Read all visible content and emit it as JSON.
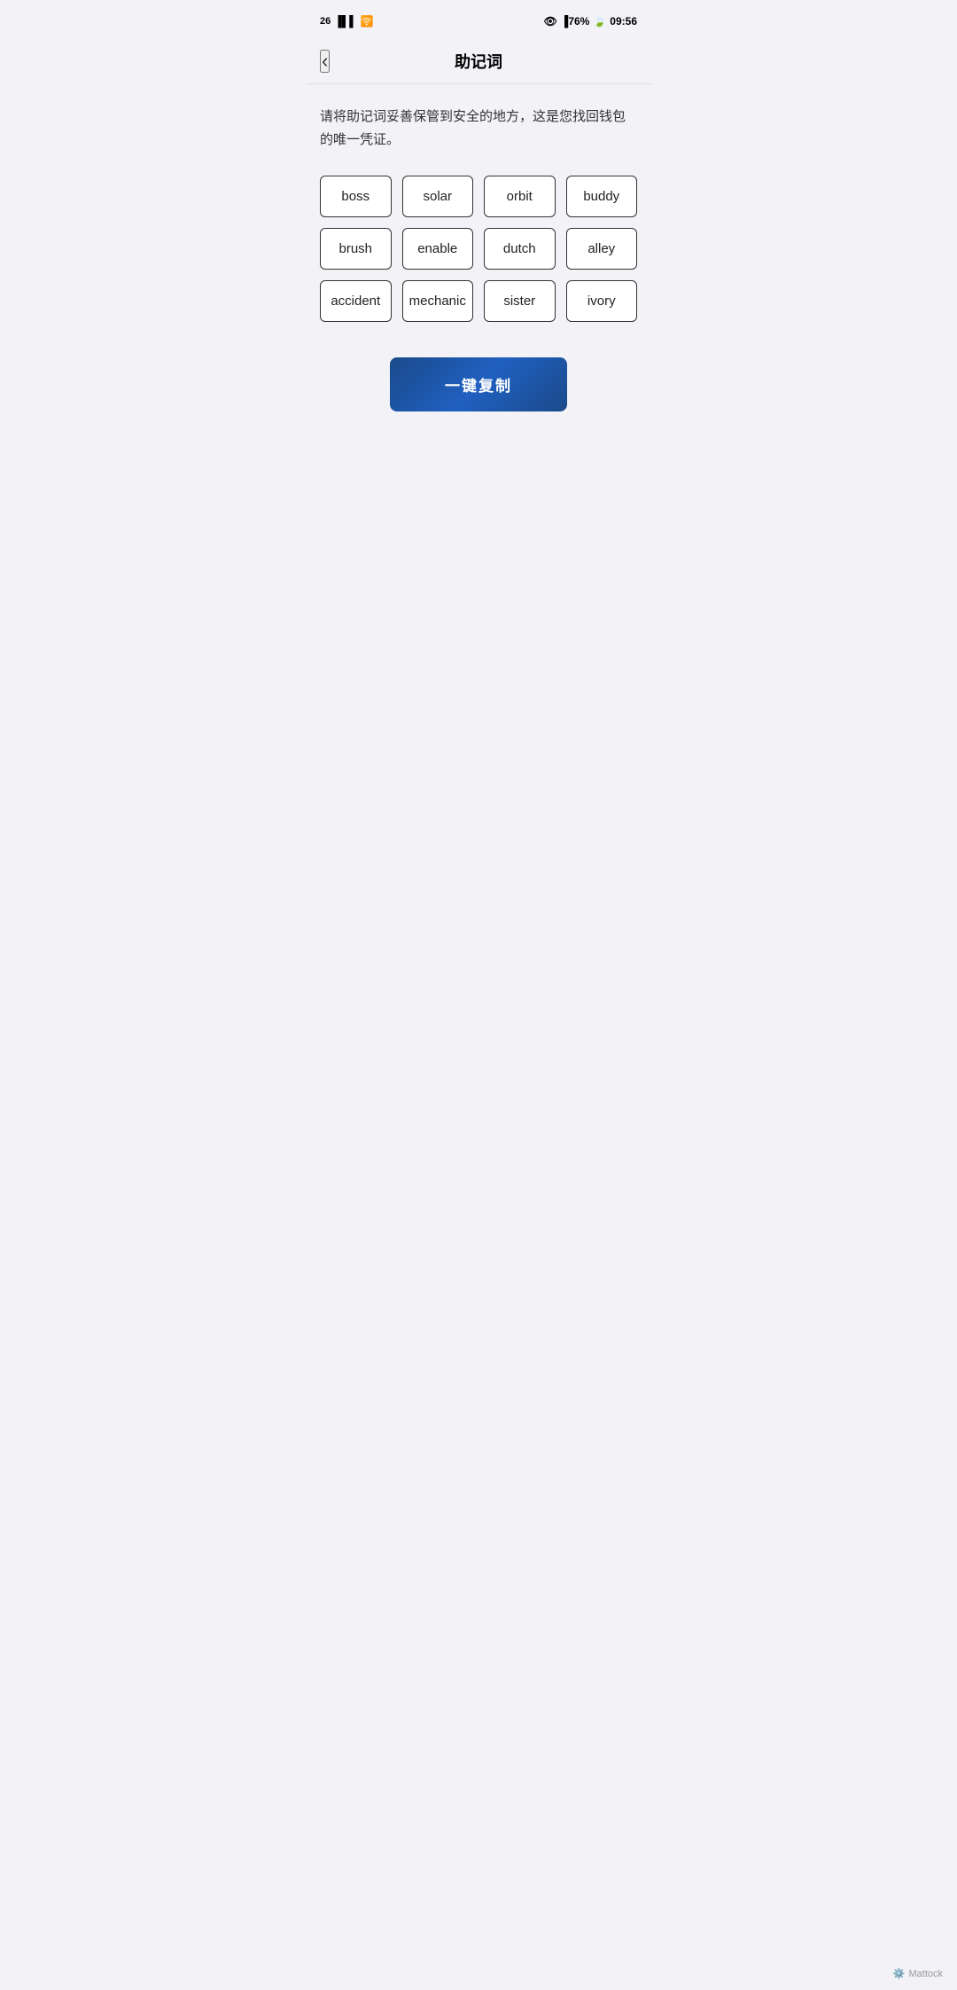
{
  "statusBar": {
    "leftText": "26",
    "signal": "▂▄▆",
    "wifi": "⊙",
    "battery": "76",
    "time": "09:56"
  },
  "header": {
    "backLabel": "‹",
    "title": "助记词"
  },
  "description": "请将助记词妥善保管到安全的地方，这是您找回钱包的唯一凭证。",
  "words": [
    {
      "id": 1,
      "text": "boss"
    },
    {
      "id": 2,
      "text": "solar"
    },
    {
      "id": 3,
      "text": "orbit"
    },
    {
      "id": 4,
      "text": "buddy"
    },
    {
      "id": 5,
      "text": "brush"
    },
    {
      "id": 6,
      "text": "enable"
    },
    {
      "id": 7,
      "text": "dutch"
    },
    {
      "id": 8,
      "text": "alley"
    },
    {
      "id": 9,
      "text": "accident"
    },
    {
      "id": 10,
      "text": "mechanic"
    },
    {
      "id": 11,
      "text": "sister"
    },
    {
      "id": 12,
      "text": "ivory"
    }
  ],
  "copyButton": {
    "label": "一键复制"
  },
  "watermark": {
    "brand": "Mattock"
  }
}
